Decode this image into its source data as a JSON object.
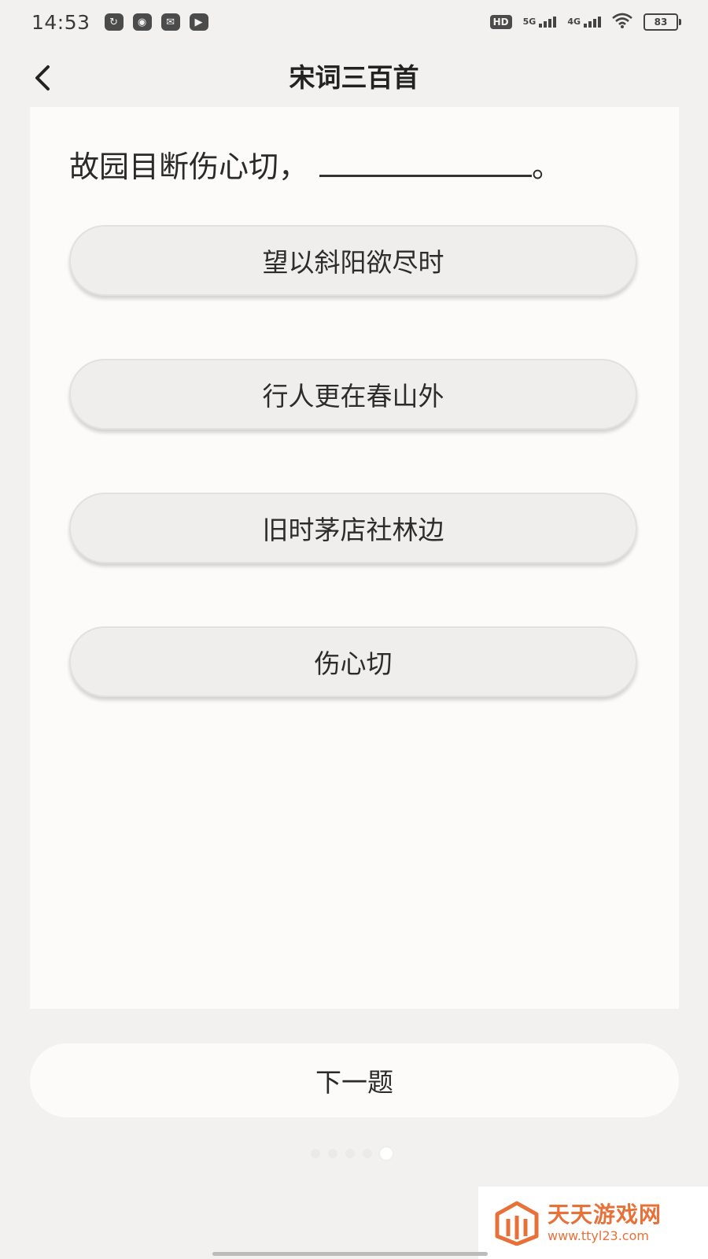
{
  "status_bar": {
    "time": "14:53",
    "notification_icons": [
      "sync-icon",
      "app-icon",
      "mail-icon",
      "video-icon"
    ],
    "hd": "HD",
    "network_5g": "5G",
    "network_4g": "4G",
    "battery_level": "83"
  },
  "header": {
    "title": "宋词三百首"
  },
  "question": {
    "text": "故园目断伤心切，",
    "end_mark": "。"
  },
  "options": [
    {
      "label": "望以斜阳欲尽时"
    },
    {
      "label": "行人更在春山外"
    },
    {
      "label": "旧时茅店社林边"
    },
    {
      "label": "伤心切"
    }
  ],
  "next_button": {
    "label": "下一题"
  },
  "pager": {
    "page_count": 5,
    "active_index": 4
  },
  "watermark": {
    "name": "天天游戏网",
    "url": "www.ttyl23.com"
  },
  "colors": {
    "background": "#f2f1ef",
    "card": "#fcfbf9",
    "option": "#efeeec",
    "watermark": "#e8713a"
  }
}
